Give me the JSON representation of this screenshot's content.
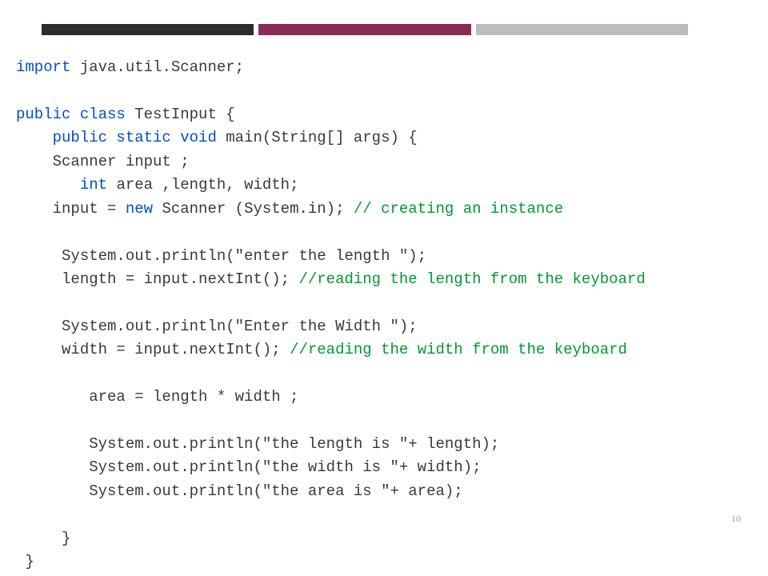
{
  "pagenum": "10",
  "code": {
    "l1_kw": "import",
    "l1_rest": " java.util.Scanner;",
    "blank": "",
    "l3_kw": "public class",
    "l3_rest": " TestInput {",
    "l4_pad": "    ",
    "l4_kw": "public static void",
    "l4_rest": " main(String[] args) {",
    "l5": "    Scanner input ;",
    "l6_pad": "       ",
    "l6_kw": "int",
    "l6_rest": " area ,length, width;",
    "l7_code": "    input = ",
    "l7_kw": "new",
    "l7_rest": " Scanner (System.in); ",
    "l7_cm": "// creating an instance",
    "l9": "     System.out.println(\"enter the length \");",
    "l10_code": "     length = input.nextInt(); ",
    "l10_cm": "//reading the length from the keyboard",
    "l12": "     System.out.println(\"Enter the Width \");",
    "l13_code": "     width = input.nextInt(); ",
    "l13_cm": "//reading the width from the keyboard",
    "l15": "        area = length * width ;",
    "l17": "        System.out.println(\"the length is \"+ length);",
    "l18": "        System.out.println(\"the width is \"+ width);",
    "l19": "        System.out.println(\"the area is \"+ area);",
    "l21": "     }",
    "l22": " }"
  }
}
